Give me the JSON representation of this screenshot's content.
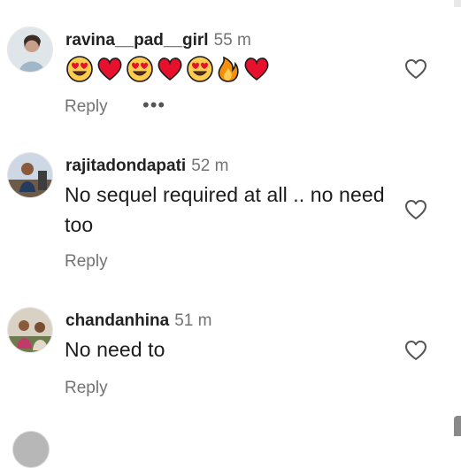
{
  "comments": [
    {
      "username": "ravina__pad__girl",
      "time": "55 m",
      "emoji_sequence": [
        "heart-eyes",
        "red-heart",
        "heart-eyes",
        "red-heart",
        "heart-eyes",
        "fire",
        "red-heart"
      ],
      "reply_label": "Reply",
      "more_label": "•••"
    },
    {
      "username": "rajitadondapati",
      "time": "52 m",
      "text": "No sequel required at all .. no need too",
      "reply_label": "Reply"
    },
    {
      "username": "chandanhina",
      "time": "51 m",
      "text": "No need to",
      "reply_label": "Reply"
    }
  ],
  "icons": {
    "like": "heart-outline-icon",
    "more": "more-options-icon"
  },
  "colors": {
    "text": "#1c1c1c",
    "muted": "#737373",
    "heart_red": "#e8112d",
    "emoji_yellow": "#ffcc4d"
  }
}
